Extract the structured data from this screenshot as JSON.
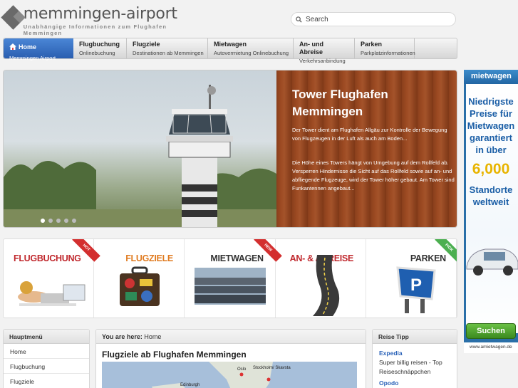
{
  "header": {
    "logo_title": "memmingen-airport",
    "logo_subtitle": "Unabhängige Informationen zum Flughafen Memmingen",
    "search_placeholder": "Search"
  },
  "nav": [
    {
      "title": "Home",
      "sub": "Memmingen Airport",
      "active": true
    },
    {
      "title": "Flugbuchung",
      "sub": "Onlinebuchung"
    },
    {
      "title": "Flugziele",
      "sub": "Destinationen ab Memmingen"
    },
    {
      "title": "Mietwagen",
      "sub": "Autovermietung Onlinebuchung"
    },
    {
      "title": "An- und Abreise",
      "sub": "Verkehrsanbindung"
    },
    {
      "title": "Parken",
      "sub": "Parkplatzinformationen"
    }
  ],
  "slide": {
    "title": "Tower Flughafen Memmingen",
    "p1": "Der Tower dient am Flughafen Allgäu zur Kontrolle der Bewegung von Flugzeugen in der Luft als auch am Boden...",
    "p2": "Die Höhe eines Towers hängt von Umgebung auf dem Rollfeld ab. Versperren Hindernisse die Sicht auf das Rollfeld sowie auf an- und abfliegende Flugzeuge, wird der Tower höher gebaut. Am Tower sind Funkantennen angebaut...",
    "dot_count": 5,
    "active_dot": 1
  },
  "categories": [
    {
      "label": "FLUGBUCHUNG",
      "color": "#c0282d",
      "ribbon": "HOT",
      "ribbon_color": "#d32f2f"
    },
    {
      "label": "FLUGZIELE",
      "color": "#e07b20",
      "ribbon": "",
      "ribbon_color": ""
    },
    {
      "label": "MIETWAGEN",
      "color": "#333333",
      "ribbon": "NEW",
      "ribbon_color": "#d32f2f"
    },
    {
      "label": "AN- & ABREISE",
      "color": "#c0282d",
      "ribbon": "",
      "ribbon_color": ""
    },
    {
      "label": "PARKEN",
      "color": "#333333",
      "ribbon": "PICK",
      "ribbon_color": "#4caf50"
    }
  ],
  "main_menu": {
    "heading": "Hauptmenü",
    "items": [
      "Home",
      "Flugbuchung",
      "Flugziele"
    ]
  },
  "breadcrumb": {
    "prefix": "You are here:",
    "current": "Home"
  },
  "article": {
    "title": "Flugziele ab Flughafen Memmingen",
    "map_labels": [
      "Oslo",
      "Stockholm/ Skavsta",
      "Edinburgh"
    ]
  },
  "reise_tipp": {
    "heading": "Reise Tipp",
    "link1": "Expedia",
    "text1": "Super billig reisen - Top Reiseschnäppchen",
    "link2": "Opodo"
  },
  "ad": {
    "brand": "mietwagen",
    "headline": "Niedrigste Preise für Mietwagen garantiert in über",
    "number": "6,000",
    "tail": "Standorte weltweit",
    "button": "Suchen",
    "url": "www.amietwagen.de"
  },
  "colors": {
    "accent": "#2a5eb0",
    "wood": "#8a3f1c",
    "link": "#2a62b8"
  }
}
